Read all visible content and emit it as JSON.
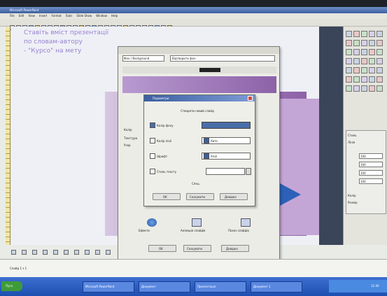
{
  "app": {
    "title": "Microsoft PowerPoint",
    "menu": [
      "File",
      "Edit",
      "View",
      "Insert",
      "Format",
      "Tools",
      "Slide Show",
      "Window",
      "Help"
    ]
  },
  "slide": {
    "text_lines": [
      "Ставіть вміст презентації",
      "по словам-автору",
      "- \"Курсо\" на мету"
    ]
  },
  "dialog_back": {
    "title": "Фон / Background",
    "field_value": "Відтворити фон",
    "buttons": [
      "Колір",
      "Текстура",
      "Узор"
    ]
  },
  "dialog_front": {
    "title": "Параметри",
    "heading": "Створити новий слайд",
    "rows": [
      {
        "label": "Колір фону",
        "value": ""
      },
      {
        "label": "Колір лінії",
        "value": "Авто"
      },
      {
        "label": "Шрифт",
        "value": "Arial"
      },
      {
        "label": "Стиль тексту",
        "value": ""
      }
    ],
    "footer_text": "Спец.",
    "buttons": [
      "OK",
      "Скасувати",
      "Довідка"
    ]
  },
  "lower_dialog": {
    "icons": [
      "Ефекти",
      "Анімація слайдів",
      "Показ слайдів"
    ],
    "buttons": [
      "OK",
      "Скасувати",
      "Довідка"
    ]
  },
  "right_panel": {
    "labels": [
      "Стиль",
      "Лінія",
      "Колір",
      "Розмір"
    ],
    "fields": [
      "100",
      "100",
      "100",
      "100"
    ]
  },
  "taskbar": {
    "start_label": "Пуск",
    "tasks": [
      "Microsoft PowerPoint",
      "Документ",
      "Презентація",
      "Документ 1"
    ],
    "clock": "12:40"
  },
  "status": {
    "text": "Слайд 1 з 1"
  },
  "colors": {
    "slide_purple": "#8d62a8",
    "titlebar_blue": "#3b5fa0",
    "dark_column": "#3a455a",
    "blue_triangle": "#2d61b8"
  }
}
